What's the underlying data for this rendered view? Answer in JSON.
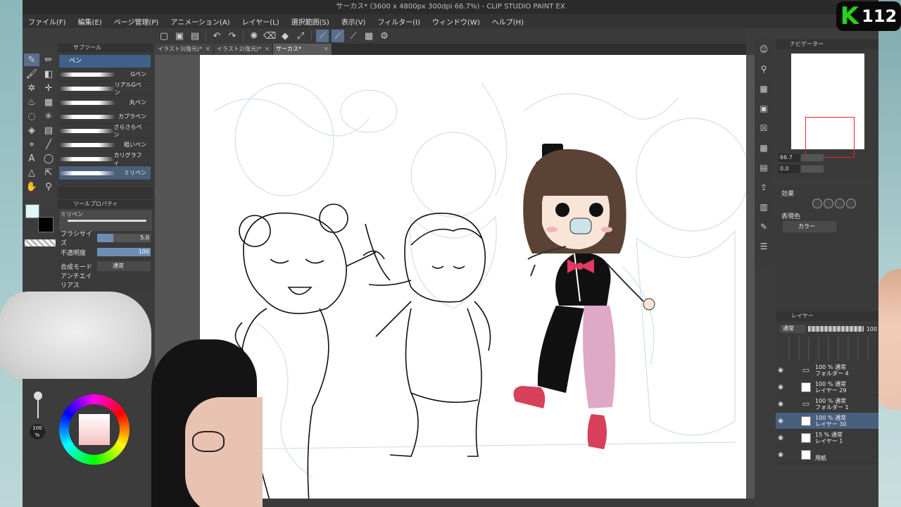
{
  "window": {
    "title": "サーカス* (3600 x 4800px 300dpi 66.7%)  - CLIP STUDIO PAINT EX"
  },
  "menu": [
    "ファイル(F)",
    "編集(E)",
    "ページ管理(P)",
    "アニメーション(A)",
    "レイヤー(L)",
    "選択範囲(S)",
    "表示(V)",
    "フィルター(I)",
    "ウィンドウ(W)",
    "ヘルプ(H)"
  ],
  "tabs": [
    {
      "label": "イラスト3(復元)*",
      "close": "×"
    },
    {
      "label": "イラスト2(復元)*",
      "close": "×"
    },
    {
      "label": "サーカス*",
      "close": "×"
    }
  ],
  "subtool": {
    "header": "サブツール",
    "group": "ペン",
    "brushes": [
      "Gペン",
      "リアルGペン",
      "丸ペン",
      "カブラペン",
      "さらさらペン",
      "粗いペン",
      "カリグラフィ",
      "ミリペン"
    ]
  },
  "tool_property": {
    "header": "ツールプロパティ",
    "brush_name": "ミリペン",
    "brush_size_label": "ブラシサイズ",
    "brush_size_value": "5.0",
    "opacity_label": "不透明度",
    "opacity_value": "100",
    "blend_label": "合成モード",
    "blend_value": "通常",
    "antialias_label": "アンチエイリアス"
  },
  "navigator": {
    "header": "ナビゲーター",
    "zoom": "66.7",
    "rotation": "0.0"
  },
  "properties": {
    "effect_label": "効果",
    "expression_color_label": "表現色",
    "expression_color_value": "カラー"
  },
  "layers": {
    "header": "レイヤー",
    "blend_mode": "通常",
    "opacity": "100",
    "items": [
      {
        "line1": "100 % 通常",
        "line2": "フォルダー 4",
        "type": "folder"
      },
      {
        "line1": "100 % 通常",
        "line2": "レイヤー 29",
        "type": "raster"
      },
      {
        "line1": "100 % 通常",
        "line2": "フォルダー 1",
        "type": "folder"
      },
      {
        "line1": "100 % 通常",
        "line2": "レイヤー 30",
        "type": "raster",
        "active": true
      },
      {
        "line1": "15 % 通常",
        "line2": "レイヤー 1",
        "type": "raster"
      },
      {
        "line1": "",
        "line2": "用紙",
        "type": "paper"
      }
    ]
  },
  "colors": {
    "main_color": "#dff6fb",
    "sub_color": "#000000"
  },
  "overlay": {
    "logo_letter": "K",
    "logo_number": "112",
    "opacity_badge": "100 %"
  }
}
